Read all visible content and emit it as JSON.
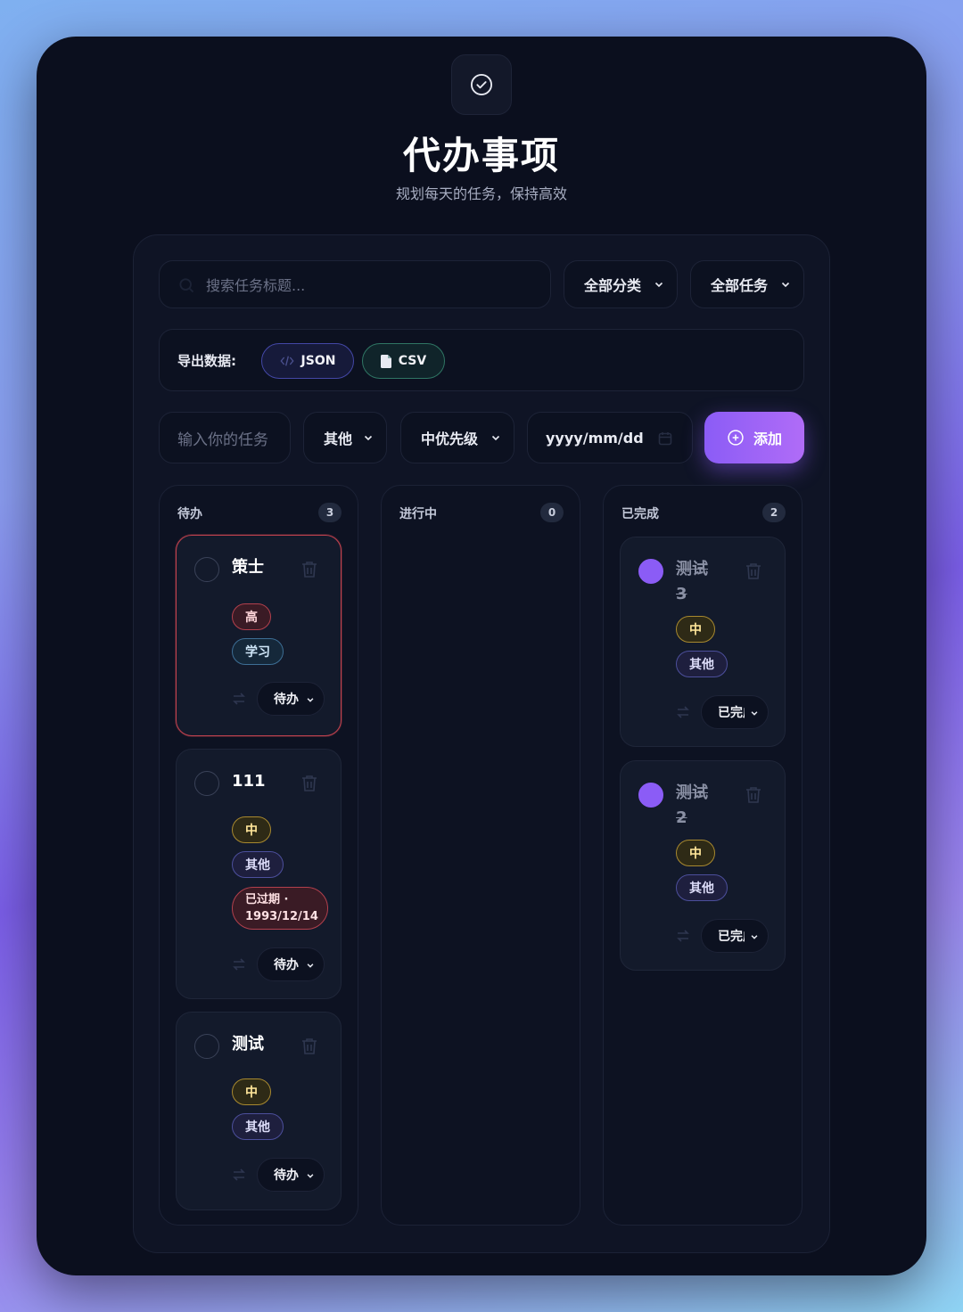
{
  "header": {
    "title": "代办事项",
    "subtitle": "规划每天的任务，保持高效"
  },
  "toolbar": {
    "search_placeholder": "搜索任务标题...",
    "category_filter": "全部分类",
    "status_filter": "全部任务"
  },
  "export": {
    "label": "导出数据:",
    "json_label": "JSON",
    "csv_label": "CSV"
  },
  "add_form": {
    "task_placeholder": "输入你的任务",
    "category": "其他",
    "priority": "中优先级",
    "date_placeholder": "yyyy/mm/dd",
    "add_label": "添加"
  },
  "columns": [
    {
      "title": "待办",
      "count": "3",
      "cards": [
        {
          "title": "策士",
          "priority": "高",
          "category": "学习",
          "status": "待办"
        },
        {
          "title": "111",
          "priority": "中",
          "category": "其他",
          "overdue": "已过期 · 1993/12/14",
          "status": "待办"
        },
        {
          "title": "测试",
          "priority": "中",
          "category": "其他",
          "status": "待办"
        }
      ]
    },
    {
      "title": "进行中",
      "count": "0",
      "cards": []
    },
    {
      "title": "已完成",
      "count": "2",
      "cards": [
        {
          "title": "测试 3",
          "priority": "中",
          "category": "其他",
          "status": "已完成"
        },
        {
          "title": "测试 2",
          "priority": "中",
          "category": "其他",
          "status": "已完成"
        }
      ]
    }
  ],
  "colors": {
    "accent": "#8b5cf6",
    "background": "#0b0f1e",
    "high_priority": "#b2404d",
    "mid_priority": "#a8892f"
  },
  "icons": {
    "logo": "check-circle-icon",
    "search": "search-icon",
    "trash": "trash-icon",
    "swap": "swap-icon",
    "calendar": "calendar-icon",
    "add": "plus-circle-icon"
  }
}
